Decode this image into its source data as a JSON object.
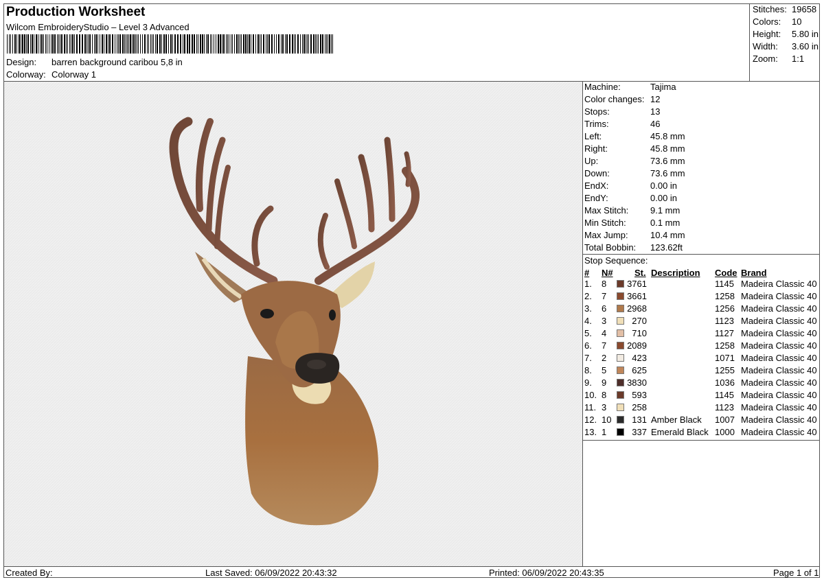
{
  "header": {
    "title": "Production Worksheet",
    "subtitle": "Wilcom EmbroideryStudio – Level 3 Advanced",
    "design_label": "Design:",
    "design_value": "barren background caribou 5,8 in",
    "colorway_label": "Colorway:",
    "colorway_value": "Colorway 1"
  },
  "stats": [
    {
      "label": "Stitches:",
      "value": "19658"
    },
    {
      "label": "Colors:",
      "value": "10"
    },
    {
      "label": "Height:",
      "value": "5.80 in"
    },
    {
      "label": "Width:",
      "value": "3.60 in"
    },
    {
      "label": "Zoom:",
      "value": "1:1"
    }
  ],
  "machine": [
    {
      "label": "Machine:",
      "value": "Tajima"
    },
    {
      "label": "Color changes:",
      "value": "12"
    },
    {
      "label": "Stops:",
      "value": "13"
    },
    {
      "label": "Trims:",
      "value": "46"
    },
    {
      "label": "Left:",
      "value": "45.8 mm"
    },
    {
      "label": "Right:",
      "value": "45.8 mm"
    },
    {
      "label": "Up:",
      "value": "73.6 mm"
    },
    {
      "label": "Down:",
      "value": "73.6 mm"
    },
    {
      "label": "EndX:",
      "value": "0.00 in"
    },
    {
      "label": "EndY:",
      "value": "0.00 in"
    },
    {
      "label": "Max Stitch:",
      "value": "9.1 mm"
    },
    {
      "label": "Min Stitch:",
      "value": "0.1 mm"
    },
    {
      "label": "Max Jump:",
      "value": "10.4 mm"
    },
    {
      "label": "Total Bobbin:",
      "value": "123.62ft"
    }
  ],
  "stop_sequence": {
    "title": "Stop Sequence:",
    "headers": {
      "num": "#",
      "needle": "N#",
      "stitches": "St.",
      "description": "Description",
      "code": "Code",
      "brand": "Brand"
    },
    "rows": [
      {
        "num": "1.",
        "needle": "8",
        "color": "#6b3a2a",
        "stitches": "3761",
        "description": "",
        "code": "1145",
        "brand": "Madeira Classic 40"
      },
      {
        "num": "2.",
        "needle": "7",
        "color": "#8a4a2e",
        "stitches": "3661",
        "description": "",
        "code": "1258",
        "brand": "Madeira Classic 40"
      },
      {
        "num": "3.",
        "needle": "6",
        "color": "#b07a4c",
        "stitches": "2968",
        "description": "",
        "code": "1256",
        "brand": "Madeira Classic 40"
      },
      {
        "num": "4.",
        "needle": "3",
        "color": "#f0dfb8",
        "stitches": "270",
        "description": "",
        "code": "1123",
        "brand": "Madeira Classic 40"
      },
      {
        "num": "5.",
        "needle": "4",
        "color": "#e2bfa6",
        "stitches": "710",
        "description": "",
        "code": "1127",
        "brand": "Madeira Classic 40"
      },
      {
        "num": "6.",
        "needle": "7",
        "color": "#8a4a2e",
        "stitches": "2089",
        "description": "",
        "code": "1258",
        "brand": "Madeira Classic 40"
      },
      {
        "num": "7.",
        "needle": "2",
        "color": "#f2ebe2",
        "stitches": "423",
        "description": "",
        "code": "1071",
        "brand": "Madeira Classic 40"
      },
      {
        "num": "8.",
        "needle": "5",
        "color": "#c0865a",
        "stitches": "625",
        "description": "",
        "code": "1255",
        "brand": "Madeira Classic 40"
      },
      {
        "num": "9.",
        "needle": "9",
        "color": "#4e2e2a",
        "stitches": "3830",
        "description": "",
        "code": "1036",
        "brand": "Madeira Classic 40"
      },
      {
        "num": "10.",
        "needle": "8",
        "color": "#6b3a2a",
        "stitches": "593",
        "description": "",
        "code": "1145",
        "brand": "Madeira Classic 40"
      },
      {
        "num": "11.",
        "needle": "3",
        "color": "#f0dfb8",
        "stitches": "258",
        "description": "",
        "code": "1123",
        "brand": "Madeira Classic 40"
      },
      {
        "num": "12.",
        "needle": "10",
        "color": "#2b2b2b",
        "stitches": "131",
        "description": "Amber Black",
        "code": "1007",
        "brand": "Madeira Classic 40"
      },
      {
        "num": "13.",
        "needle": "1",
        "color": "#000000",
        "stitches": "337",
        "description": "Emerald Black",
        "code": "1000",
        "brand": "Madeira Classic 40"
      }
    ]
  },
  "footer": {
    "created_by": "Created By:",
    "last_saved": "Last Saved: 06/09/2022 20:43:32",
    "printed": "Printed: 06/09/2022 20:43:35",
    "page": "Page 1 of 1"
  }
}
